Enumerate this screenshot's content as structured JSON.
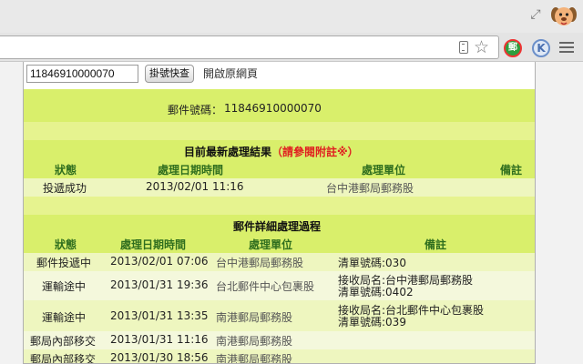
{
  "popup": {
    "tracking_input_value": "11846910000070",
    "query_button_label": "掛號快查",
    "open_page_label": "開啟原網頁"
  },
  "parcel": {
    "label": "郵件號碼：",
    "number": "11846910000070"
  },
  "latest": {
    "title": "目前最新處理結果",
    "note": "（請參閱附註※）",
    "headers": [
      "狀態",
      "處理日期時間",
      "處理單位",
      "備註"
    ],
    "row": {
      "status": "投遞成功",
      "datetime": "2013/02/01 11:16",
      "unit": "台中港郵局郵務股",
      "remark": ""
    }
  },
  "details": {
    "title": "郵件詳細處理過程",
    "headers": [
      "狀態",
      "處理日期時間",
      "處理單位",
      "備註"
    ],
    "rows": [
      {
        "status": "郵件投遞中",
        "datetime": "2013/02/01 07:06",
        "unit": "台中港郵局郵務股",
        "remark1": "清單號碼:030",
        "remark2": ""
      },
      {
        "status": "運輸途中",
        "datetime": "2013/01/31 19:36",
        "unit": "台北郵件中心包裹股",
        "remark1": "接收局名:台中港郵局郵務股",
        "remark2": "清單號碼:0402"
      },
      {
        "status": "運輸途中",
        "datetime": "2013/01/31 13:35",
        "unit": "南港郵局郵務股",
        "remark1": "接收局名:台北郵件中心包裹股",
        "remark2": "清單號碼:039"
      },
      {
        "status": "郵局內部移交",
        "datetime": "2013/01/31 11:16",
        "unit": "南港郵局郵務股",
        "remark1": "",
        "remark2": ""
      },
      {
        "status": "郵局內部移交",
        "datetime": "2013/01/30 18:56",
        "unit": "南港郵局郵務股",
        "remark1": "",
        "remark2": ""
      }
    ]
  },
  "icons": {
    "extension_post": "郵",
    "extension_k": "K",
    "star": "☆",
    "resize": "⤢"
  },
  "colors": {
    "header_green": "#2f6e1e",
    "note_red": "#e02020",
    "band_yellow": "#d9ef6b",
    "extension_green": "#2e9e3e"
  }
}
